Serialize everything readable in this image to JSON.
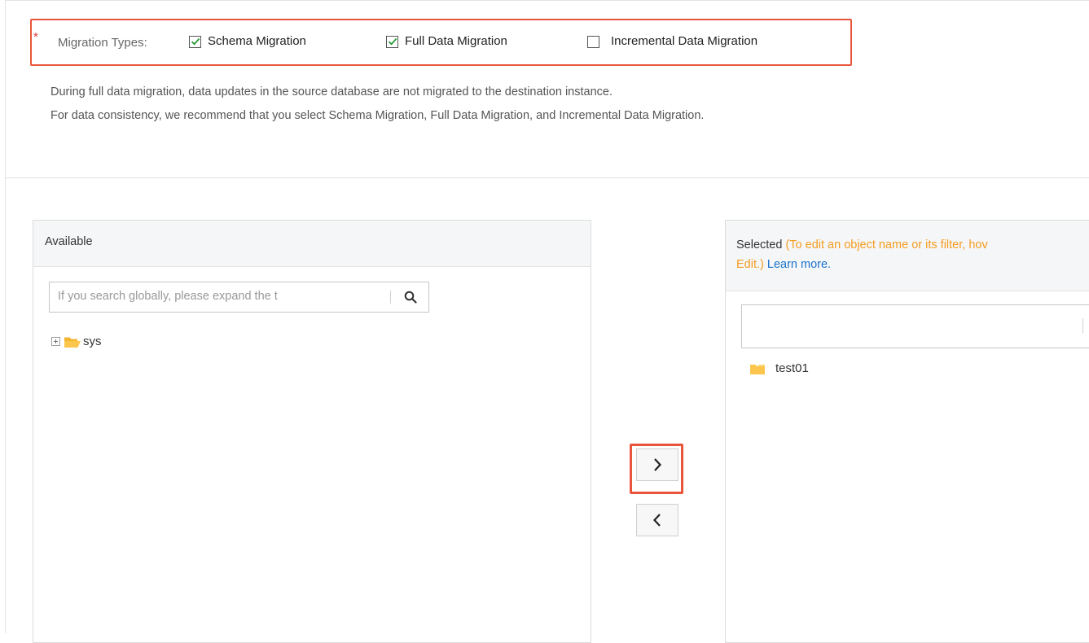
{
  "migration": {
    "required_mark": "*",
    "label": "Migration Types:",
    "options": [
      {
        "label": "Schema Migration",
        "checked": true
      },
      {
        "label": "Full Data Migration",
        "checked": true
      },
      {
        "label": "Incremental Data Migration",
        "checked": false
      }
    ]
  },
  "notes": [
    "During full data migration, data updates in the source database are not migrated to the destination instance.",
    "For data consistency, we recommend that you select Schema Migration, Full Data Migration, and Incremental Data Migration."
  ],
  "available": {
    "title": "Available",
    "search_placeholder": "If you search globally, please expand the t",
    "tree": [
      {
        "label": "sys"
      }
    ]
  },
  "selected": {
    "title": "Selected",
    "hint_line1": "(To edit an object name or its filter, hov",
    "hint_line2": "Edit.)",
    "learn_more": "Learn more.",
    "items": [
      {
        "label": "test01"
      }
    ]
  },
  "colors": {
    "highlight": "#e8553a",
    "hint": "#f39c1f",
    "link": "#1a72c9",
    "folder": "#fcc64c"
  }
}
